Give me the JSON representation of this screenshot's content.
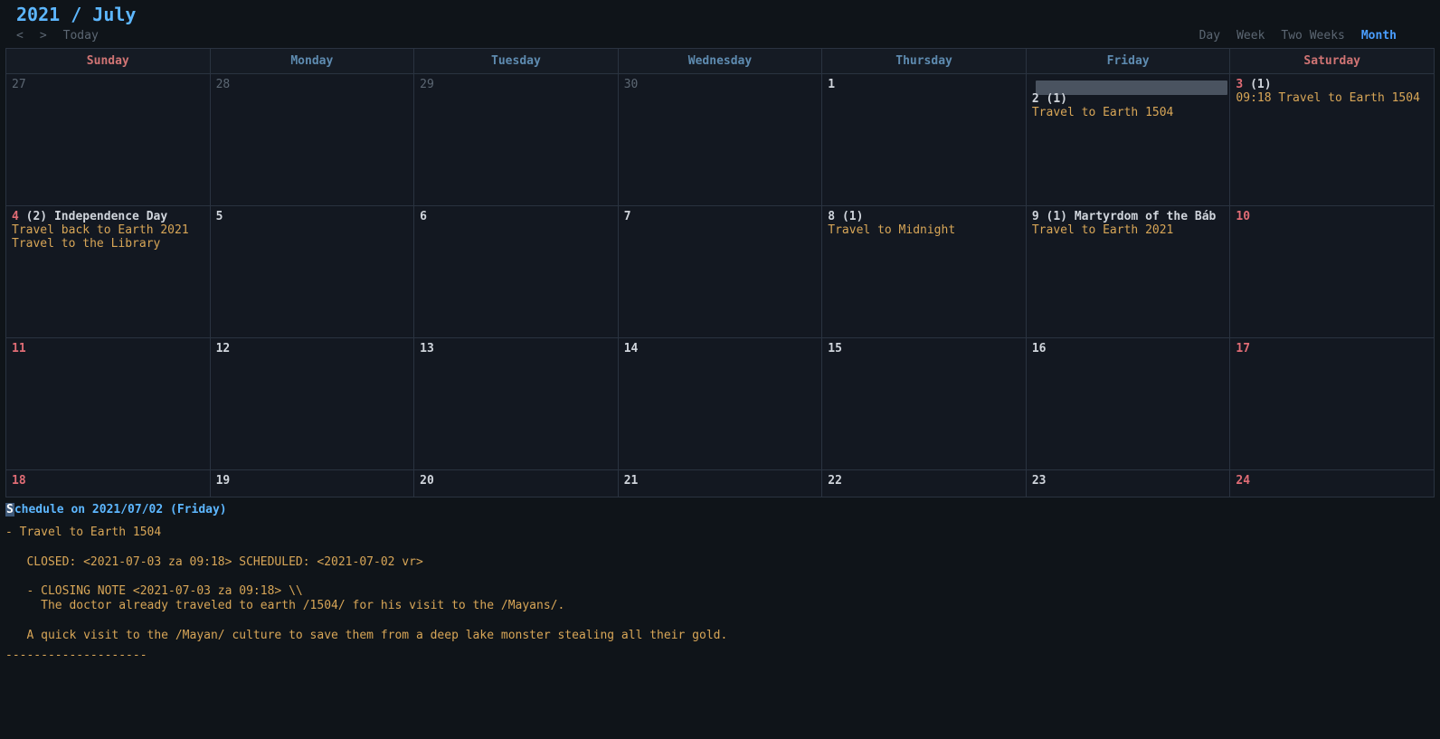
{
  "title": "2021 / July",
  "nav": {
    "prev": "<",
    "next": ">",
    "today": "Today"
  },
  "views": {
    "day": "Day",
    "week": "Week",
    "two_weeks": "Two Weeks",
    "month": "Month",
    "active": "month"
  },
  "dayHeaders": [
    "Sunday",
    "Monday",
    "Tuesday",
    "Wednesday",
    "Thursday",
    "Friday",
    "Saturday"
  ],
  "weekendCols": [
    0,
    6
  ],
  "rows": [
    [
      {
        "num": "27",
        "other": true
      },
      {
        "num": "28",
        "other": true
      },
      {
        "num": "29",
        "other": true
      },
      {
        "num": "30",
        "other": true
      },
      {
        "num": "1"
      },
      {
        "num": "2",
        "count": "(1)",
        "selected": true,
        "events": [
          "Travel to Earth 1504"
        ]
      },
      {
        "num": "3",
        "count": "(1)",
        "events": [
          "09:18 Travel to Earth 1504"
        ]
      }
    ],
    [
      {
        "num": "4",
        "count": "(2)",
        "holiday": "Independence Day",
        "events": [
          "Travel back to Earth 2021",
          "Travel to the Library"
        ]
      },
      {
        "num": "5"
      },
      {
        "num": "6"
      },
      {
        "num": "7"
      },
      {
        "num": "8",
        "count": "(1)",
        "events": [
          "Travel to Midnight"
        ]
      },
      {
        "num": "9",
        "count": "(1)",
        "holiday": "Martyrdom of the Báb",
        "events": [
          "Travel to Earth 2021"
        ]
      },
      {
        "num": "10"
      }
    ],
    [
      {
        "num": "11"
      },
      {
        "num": "12"
      },
      {
        "num": "13"
      },
      {
        "num": "14"
      },
      {
        "num": "15"
      },
      {
        "num": "16"
      },
      {
        "num": "17"
      }
    ],
    [
      {
        "num": "18"
      },
      {
        "num": "19"
      },
      {
        "num": "20"
      },
      {
        "num": "21"
      },
      {
        "num": "22"
      },
      {
        "num": "23"
      },
      {
        "num": "24"
      }
    ]
  ],
  "details": {
    "heading_first_char": "S",
    "heading_rest": "chedule on 2021/07/02 (Friday)",
    "body": "- Travel to Earth 1504\n\n   CLOSED: <2021-07-03 za 09:18> SCHEDULED: <2021-07-02 vr>\n\n   - CLOSING NOTE <2021-07-03 za 09:18> \\\\\n     The doctor already traveled to earth /1504/ for his visit to the /Mayans/.\n\n   A quick visit to the /Mayan/ culture to save them from a deep lake monster stealing all their gold.",
    "divider": "--------------------"
  }
}
